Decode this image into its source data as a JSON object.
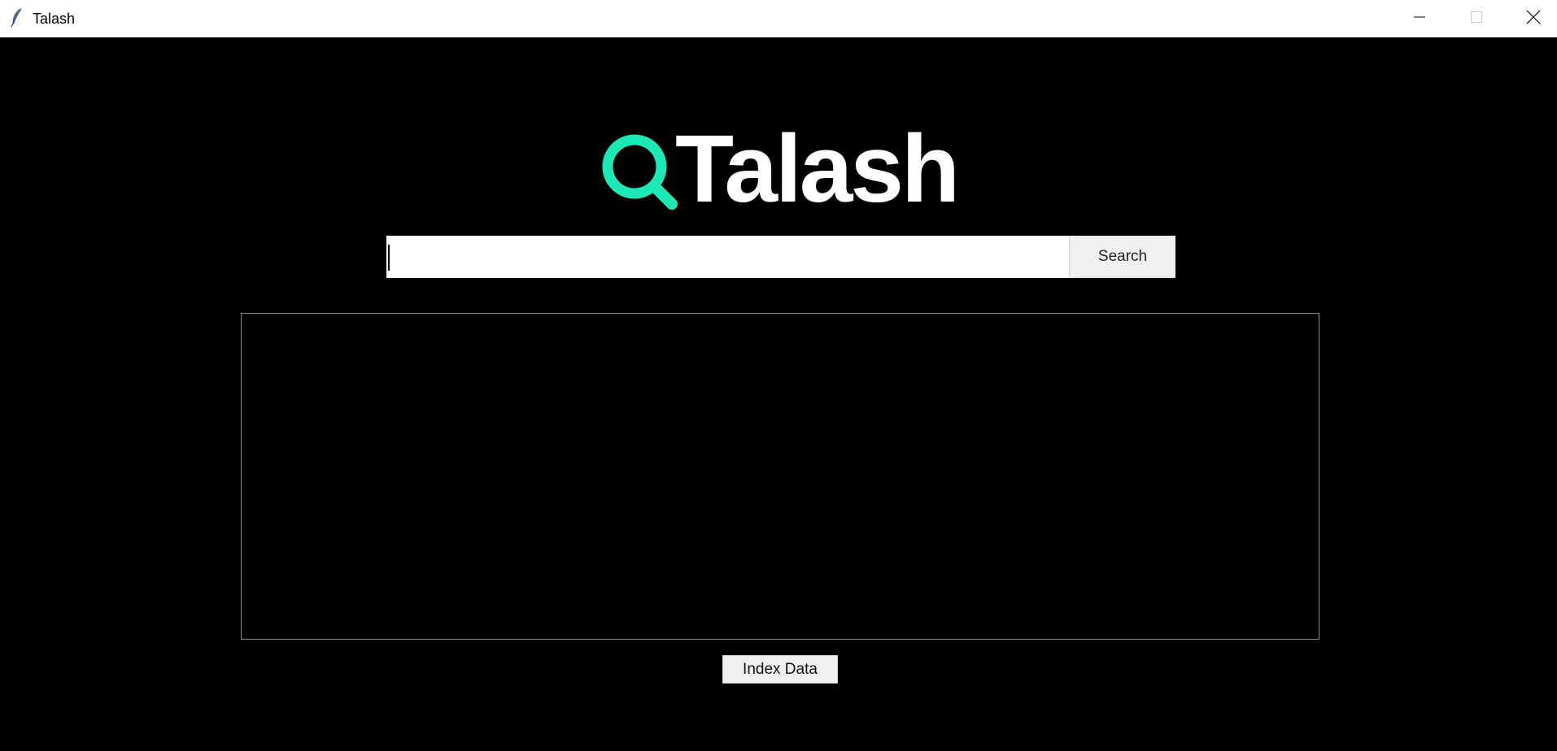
{
  "window": {
    "title": "Talash",
    "app_icon": "feather-icon",
    "controls": {
      "minimize": "minimize-icon",
      "maximize": "maximize-icon",
      "close": "close-icon"
    }
  },
  "logo": {
    "icon": "magnifier-icon",
    "text": "Talash",
    "accent_color": "#1de9b6",
    "text_color": "#ffffff"
  },
  "search": {
    "value": "",
    "placeholder": "",
    "button_label": "Search"
  },
  "results": {
    "items": []
  },
  "actions": {
    "index_label": "Index Data"
  },
  "colors": {
    "background": "#000000",
    "titlebar": "#ffffff",
    "button_bg": "#f0f0f0"
  }
}
